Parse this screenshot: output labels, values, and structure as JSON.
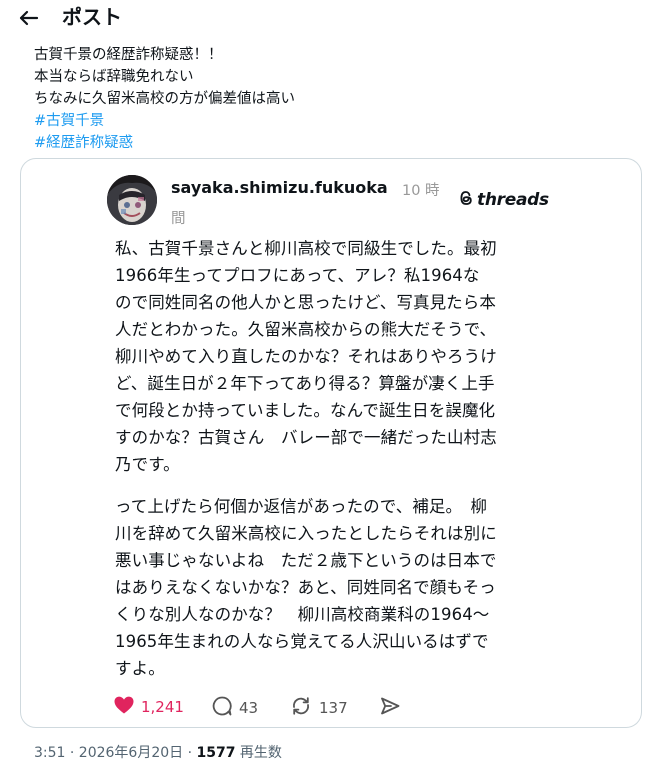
{
  "header": {
    "title": "ポスト"
  },
  "post": {
    "lines": [
      "古賀千景の経歴詐称疑惑！！",
      "本当ならば辞職免れない",
      "ちなみに久留米高校の方が偏差値は高い"
    ],
    "hashtags": [
      "#古賀千景",
      "#経歴詐称疑惑"
    ]
  },
  "embed": {
    "username": "sayaka.shimizu.fukuoka",
    "time": "10 時間",
    "platform": "threads",
    "paragraph1": [
      "私、古賀千景さんと柳川高校で同級生でした。最初",
      "1966年生ってプロフにあって、アレ？私1964な",
      "ので同姓同名の他人かと思ったけど、写真見たら本",
      "人だとわかった。久留米高校からの熊大だそうで、",
      "柳川やめて入り直したのかな？それはありやろうけ",
      "ど、誕生日が２年下ってあり得る？算盤が凄く上手",
      "で何段とか持っていました。なんで誕生日を誤魔化",
      "すのかな？古賀さん　バレー部で一緒だった山村志",
      "乃です。"
    ],
    "paragraph2": [
      "って上げたら何個か返信があったので、補足。　柳",
      "川を辞めて久留米高校に入ったとしたらそれは別に",
      "悪い事じゃないよね　ただ２歳下というのは日本で",
      "はありえなくないかな？あと、同姓同名で顔もそっ",
      "くりな別人なのかな？　柳川高校商業科の1964～",
      "1965年生まれの人なら覚えてる人沢山いるはずで",
      "すよ。"
    ],
    "stats": {
      "likes": "1,241",
      "replies": "43",
      "reposts": "137"
    },
    "colors": {
      "like": "#e0245e"
    }
  },
  "footer": {
    "datetime": "3:51 · 2026年6月20日 · ",
    "views": "1577",
    "views_label": " 再生数"
  }
}
